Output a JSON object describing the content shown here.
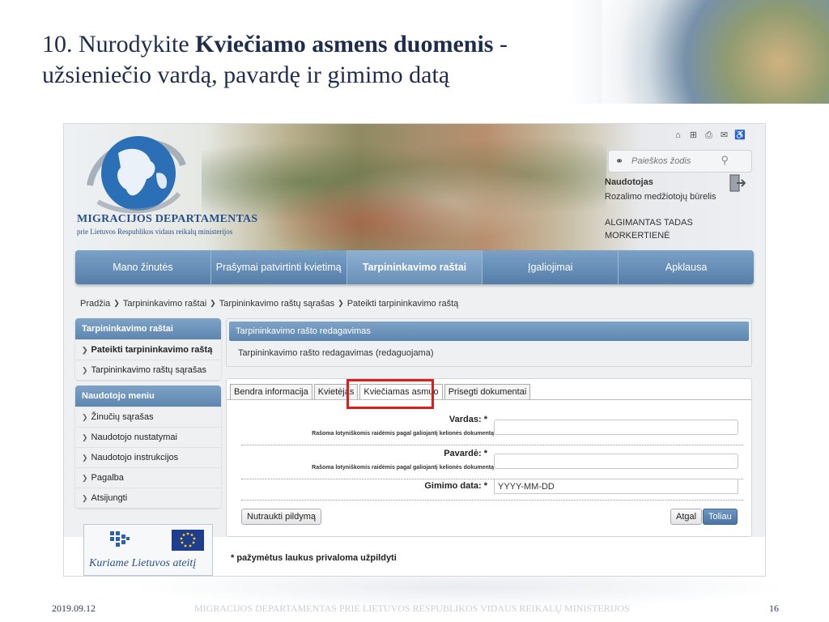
{
  "slide": {
    "title_prefix": "10. Nurodykite ",
    "title_bold": "Kviečiamo asmens duomenis",
    "title_suffix": " -",
    "title_line2": "užsieniečio vardą, pavardę ir gimimo datą",
    "footer_date": "2019.09.12",
    "footer_org": "MIGRACIJOS DEPARTAMENTAS PRIE LIETUVOS RESPUBLIKOS VIDAUS REIKALŲ MINISTERIJOS",
    "page_number": "16"
  },
  "site": {
    "logo_title": "MIGRACIJOS DEPARTAMENTAS",
    "logo_subtitle": "prie Lietuvos Respublikos vidaus reikalų ministerijos",
    "search_placeholder": "Paieškos žodis",
    "user_label": "Naudotojas",
    "user_org": "Rozalimo medžiotojų būrelis",
    "user_name_line1": "ALGIMANTAS TADAS",
    "user_name_line2": "MORKERTIENĖ",
    "top_icons": [
      "home-icon",
      "sitemap-icon",
      "print-icon",
      "mail-icon",
      "accessibility-icon"
    ]
  },
  "nav": {
    "items": [
      {
        "label": "Mano žinutės"
      },
      {
        "label": "Prašymai patvirtinti kvietimą"
      },
      {
        "label": "Tarpininkavimo raštai"
      },
      {
        "label": "Įgaliojimai"
      },
      {
        "label": "Apklausa"
      }
    ],
    "active_index": 2
  },
  "breadcrumb": [
    "Pradžia",
    "Tarpininkavimo raštai",
    "Tarpininkavimo raštų sąrašas",
    "Pateikti tarpininkavimo raštą"
  ],
  "sidebar": {
    "section1_title": "Tarpininkavimo raštai",
    "section1_items": [
      "Pateikti tarpininkavimo raštą",
      "Tarpininkavimo raštų sąrašas"
    ],
    "section2_title": "Naudotojo meniu",
    "section2_items": [
      "Žinučių sąrašas",
      "Naudotojo nustatymai",
      "Naudotojo instrukcijos",
      "Pagalba",
      "Atsijungti"
    ],
    "eu_slogan": "Kuriame Lietuvos ateitį"
  },
  "edit_panel": {
    "header": "Tarpininkavimo rašto redagavimas",
    "status": "Tarpininkavimo rašto redagavimas (redaguojama)"
  },
  "form": {
    "tabs": [
      "Bendra informacija",
      "Kvietėjas",
      "Kviečiamas asmuo",
      "Prisegti dokumentai"
    ],
    "active_tab": 2,
    "first_name_label": "Vardas: *",
    "first_name_hint": "Rašoma lotyniškomis raidėmis pagal galiojantį kelionės dokumentą",
    "first_name_value": "",
    "last_name_label": "Pavardė: *",
    "last_name_hint": "Rašoma lotyniškomis raidėmis pagal galiojantį kelionės dokumentą",
    "last_name_value": "",
    "birth_label": "Gimimo data: *",
    "birth_placeholder": "YYYY-MM-DD",
    "cancel_button": "Nutraukti pildymą",
    "back_button": "Atgal",
    "next_button": "Toliau",
    "required_note": "* pažymėtus laukus privaloma užpildyti",
    "highlight_color": "#e01b1b"
  }
}
